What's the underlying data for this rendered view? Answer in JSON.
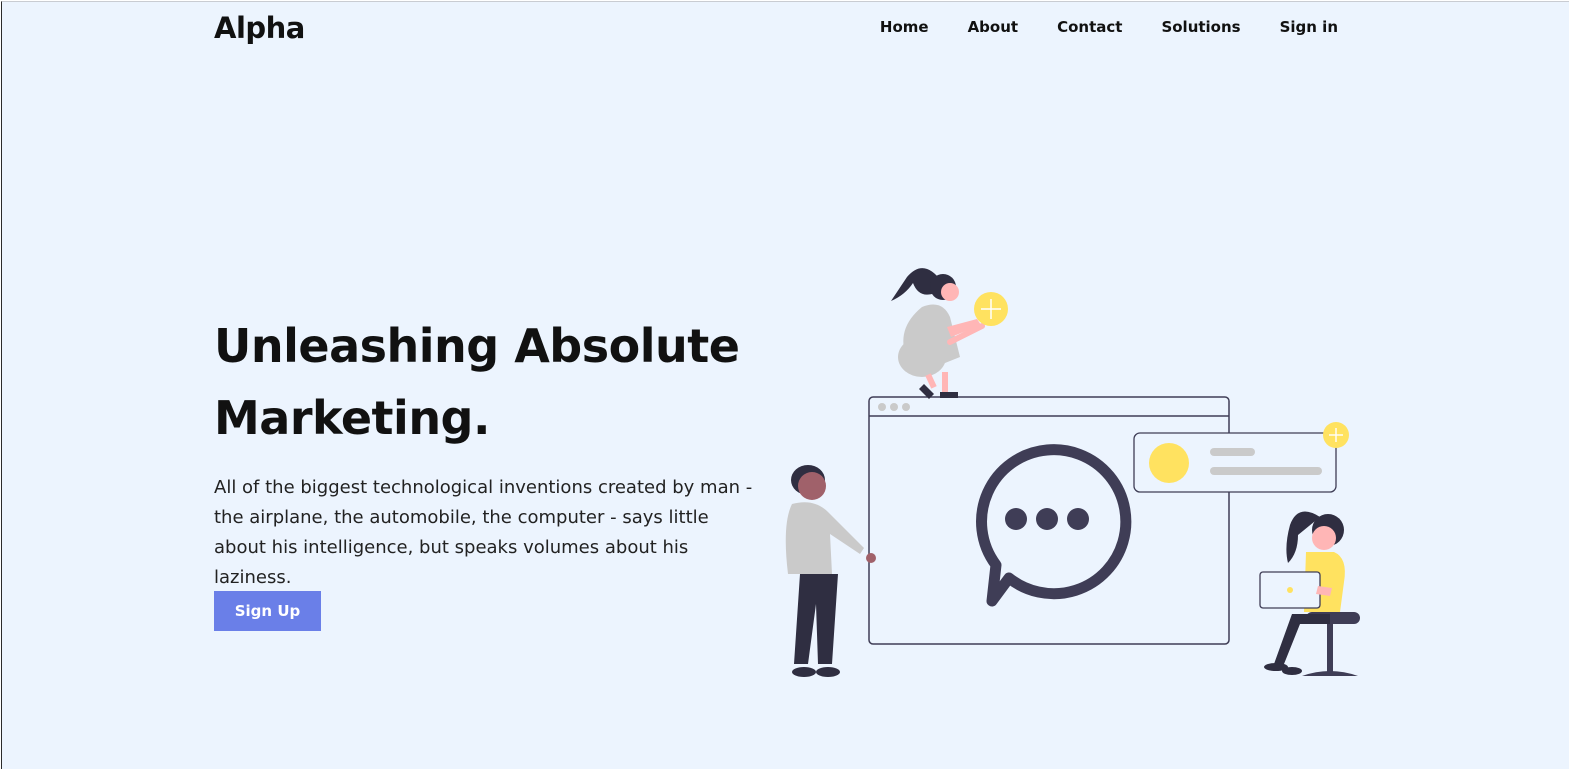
{
  "brand": {
    "name": "Alpha"
  },
  "nav": {
    "items": [
      "Home",
      "About",
      "Contact",
      "Solutions",
      "Sign in"
    ]
  },
  "hero": {
    "title": "Unleashing Absolute Marketing.",
    "text": "All of the biggest technological inventions created by man - the airplane, the automobile, the computer - says little about his intelligence, but speaks volumes about his laziness.",
    "cta_label": "Sign Up"
  },
  "colors": {
    "background": "#ecf4fe",
    "accent": "#6a7fe8",
    "illustration_dark": "#3f3d56",
    "illustration_yellow": "#ffe260",
    "illustration_gray": "#cacaca",
    "illustration_skin": "#ffb6b6"
  },
  "illustration": {
    "icons": [
      "chat-bubble-icon",
      "plus-icon",
      "laptop-icon"
    ]
  }
}
